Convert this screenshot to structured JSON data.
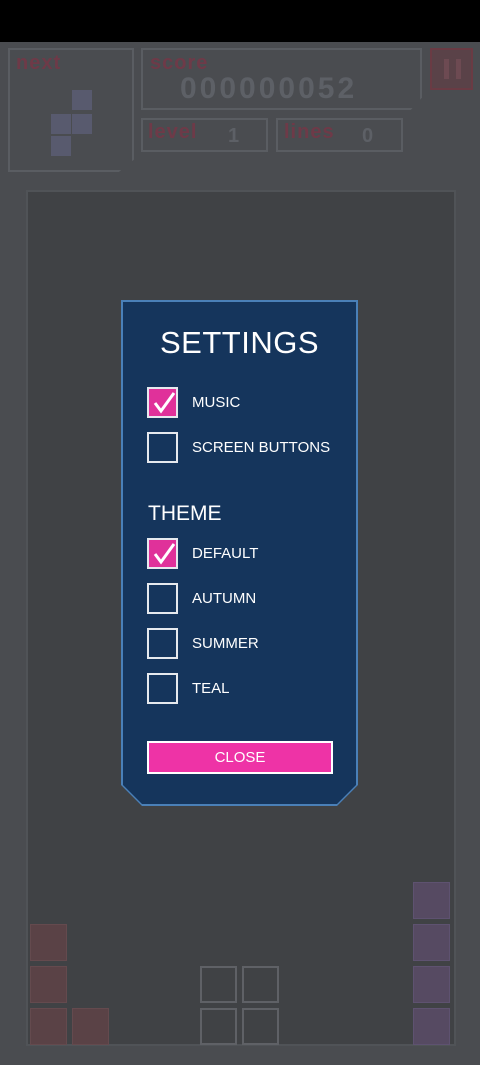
{
  "hud": {
    "next_label": "next",
    "score_label": "score",
    "score_value": "000000052",
    "level_label": "level",
    "level_value": "1",
    "lines_label": "lines",
    "lines_value": "0",
    "pause_icon": "pause-icon"
  },
  "settings": {
    "title": "SETTINGS",
    "music": {
      "label": "MUSIC",
      "checked": true
    },
    "screen_buttons": {
      "label": "SCREEN BUTTONS",
      "checked": false
    },
    "theme_title": "THEME",
    "themes": [
      {
        "label": "DEFAULT",
        "checked": true
      },
      {
        "label": "AUTUMN",
        "checked": false
      },
      {
        "label": "SUMMER",
        "checked": false
      },
      {
        "label": "TEAL",
        "checked": false
      }
    ],
    "close_label": "CLOSE"
  },
  "colors": {
    "accent": "#ee33a6",
    "dialog_bg": "#15355c",
    "dialog_border": "#4a80b8"
  }
}
